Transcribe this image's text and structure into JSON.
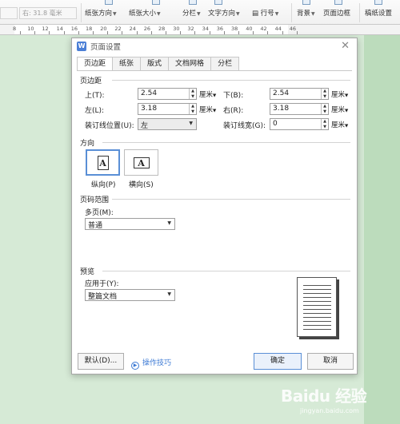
{
  "ribbon": {
    "size_input": "右: 31.8 毫米",
    "paper_direction": "纸张方向",
    "paper_size": "纸张大小",
    "columns": "分栏",
    "text_direction": "文字方向",
    "line_number": "行号",
    "background": "背景",
    "page_border": "页面边框",
    "manuscript": "稿纸设置"
  },
  "ruler": {
    "ticks": [
      "8",
      "10",
      "12",
      "14",
      "16",
      "18",
      "20",
      "22",
      "24",
      "26",
      "28",
      "30",
      "32",
      "34",
      "36",
      "38",
      "40",
      "42",
      "44",
      "46"
    ]
  },
  "dialog": {
    "title": "页面设置",
    "app_icon": "W",
    "tabs": [
      "页边距",
      "纸张",
      "版式",
      "文档网格",
      "分栏"
    ],
    "margins": {
      "section": "页边距",
      "top_label": "上(T):",
      "top_value": "2.54",
      "bottom_label": "下(B):",
      "bottom_value": "2.54",
      "left_label": "左(L):",
      "left_value": "3.18",
      "right_label": "右(R):",
      "right_value": "3.18",
      "unit": "厘米",
      "gutter_pos_label": "装订线位置(U):",
      "gutter_pos_value": "左",
      "gutter_width_label": "装订线宽(G):",
      "gutter_width_value": "0"
    },
    "orientation": {
      "section": "方向",
      "portrait_label": "纵向(P)",
      "landscape_label": "横向(S)",
      "glyph": "A"
    },
    "pages": {
      "section": "页码范围",
      "multi_label": "多页(M):",
      "multi_value": "普通"
    },
    "preview": {
      "section": "预览",
      "apply_label": "应用于(Y):",
      "apply_value": "整篇文档"
    },
    "buttons": {
      "default": "默认(D)...",
      "tips": "操作技巧",
      "ok": "确定",
      "cancel": "取消"
    }
  },
  "watermark": {
    "main": "Baidu 经验",
    "sub": "jingyan.baidu.com"
  }
}
